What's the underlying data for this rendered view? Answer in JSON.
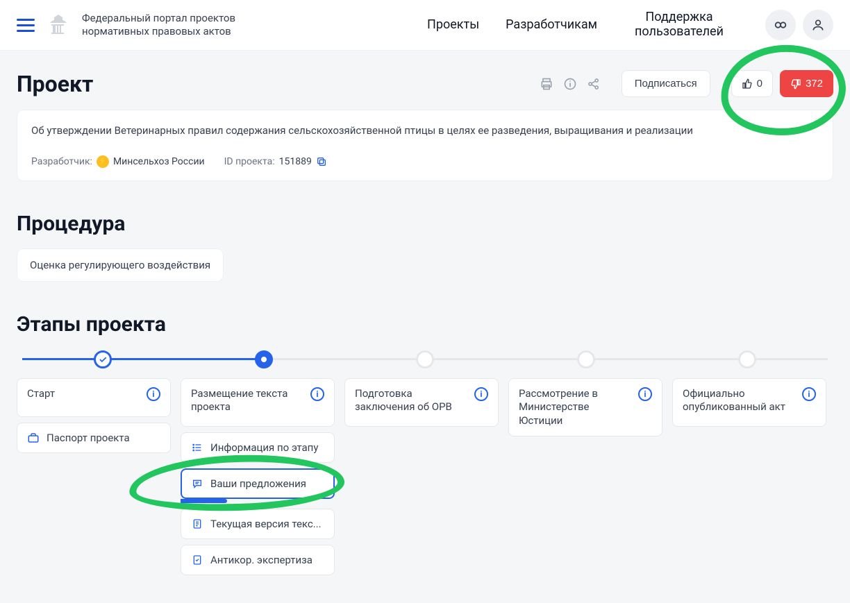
{
  "header": {
    "site_title": "Федеральный портал проектов нормативных правовых актов",
    "nav": {
      "projects": "Проекты",
      "developers": "Разработчикам",
      "support": "Поддержка пользователей"
    }
  },
  "project": {
    "heading": "Проект",
    "subscribe": "Подписаться",
    "likes": "0",
    "dislikes": "372",
    "title": "Об утверждении Ветеринарных правил содержания сельскохозяйственной птицы в целях ее разведения, выращивания и реализации",
    "developer_label": "Разработчик:",
    "developer": "Минсельхоз России",
    "id_label": "ID проекта:",
    "id": "151889"
  },
  "procedure": {
    "heading": "Процедура",
    "chip": "Оценка регулирующего воздействия"
  },
  "stages": {
    "heading": "Этапы проекта",
    "cols": [
      {
        "title": "Старт",
        "passport": "Паспорт проекта"
      },
      {
        "title": "Размещение текста проекта",
        "sub": [
          "Информация по этапу",
          "Ваши предложения",
          "Текущая версия текс...",
          "Антикор. экспертиза"
        ]
      },
      {
        "title": "Подготовка заключения об ОРВ"
      },
      {
        "title": "Рассмотрение в Министерстве Юстиции"
      },
      {
        "title": "Официально опубликованный акт"
      }
    ]
  }
}
